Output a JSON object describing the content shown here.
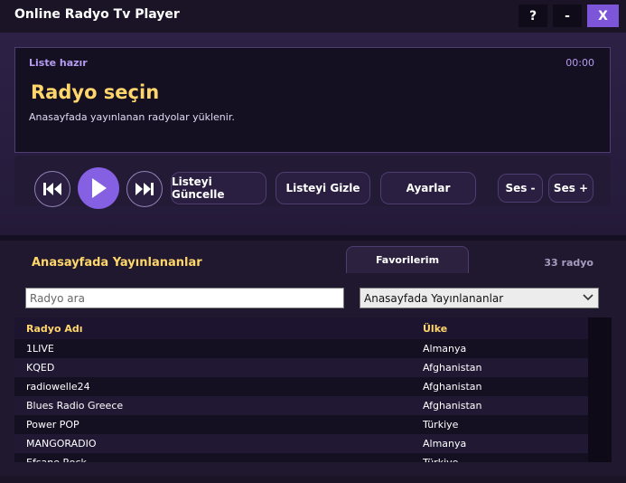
{
  "window": {
    "title": "Online Radyo Tv Player",
    "help_label": "?",
    "minimize_label": "-",
    "close_label": "X"
  },
  "now_playing": {
    "status": "Liste hazır",
    "time": "00:00",
    "title": "Radyo seçin",
    "subtitle": "Anasayfada yayınlanan radyolar yüklenir."
  },
  "controls": {
    "refresh_label": "Listeyi Güncelle",
    "hide_label": "Listeyi Gizle",
    "settings_label": "Ayarlar",
    "volume_down_label": "Ses -",
    "volume_up_label": "Ses +"
  },
  "list": {
    "title": "Anasayfada Yayınlananlar",
    "favorites_tab": "Favorilerim",
    "count": "33 radyo",
    "search_placeholder": "Radyo ara",
    "category_selected": "Anasayfada Yayınlananlar",
    "columns": {
      "name": "Radyo Adı",
      "country": "Ülke"
    },
    "rows": [
      {
        "name": "1LIVE",
        "country": "Almanya"
      },
      {
        "name": "KQED",
        "country": "Afghanistan"
      },
      {
        "name": "radiowelle24",
        "country": "Afghanistan"
      },
      {
        "name": "Blues Radio Greece",
        "country": "Afghanistan"
      },
      {
        "name": "Power POP",
        "country": "Türkiye"
      },
      {
        "name": "MANGORADIO",
        "country": "Almanya"
      },
      {
        "name": "Efsane Rock",
        "country": "Türkiye"
      }
    ]
  },
  "colors": {
    "accent": "#8560e3",
    "heading": "#ffd66b",
    "status": "#b59cf0"
  }
}
